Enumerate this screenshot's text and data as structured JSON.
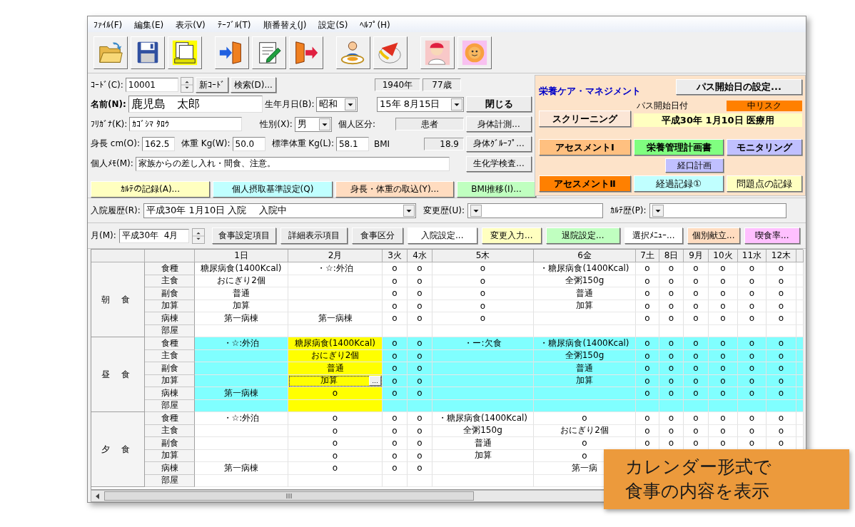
{
  "menu": [
    "ﾌｧｲﾙ(F)",
    "編集(E)",
    "表示(V)",
    "ﾃｰﾌﾞﾙ(T)",
    "順番替え(J)",
    "設定(S)",
    "ﾍﾙﾌﾟ(H)"
  ],
  "form": {
    "code": {
      "label": "ｺｰﾄﾞ(C):",
      "value": "10001"
    },
    "new_code_button": "新ｺｰﾄﾞ",
    "search_button": "検索(D)...",
    "birth_year": "1940年",
    "age": "77歳",
    "name": {
      "label": "名前(N):",
      "value": "鹿児島　太郎"
    },
    "birthdate": {
      "label": "生年月日(B):",
      "era": "昭和",
      "date": "15年 8月15日"
    },
    "kana": {
      "label": "ﾌﾘｶﾞﾅ(K):",
      "value": "ｶｺﾞｼﾏ ﾀﾛｳ"
    },
    "sex": {
      "label": "性別(X):",
      "value": "男"
    },
    "category": {
      "label": "個人区分:",
      "value": "患者"
    },
    "height": {
      "label": "身長 cm(O):",
      "value": "162.5"
    },
    "weight": {
      "label": "体重 Kg(W):",
      "value": "50.0"
    },
    "std_weight": {
      "label": "標準体重 Kg(L):",
      "value": "58.1"
    },
    "bmi": {
      "label": "BMI",
      "value": "18.9"
    },
    "memo": {
      "label": "個人ﾒﾓ(M):",
      "value": "家族からの差し入れ・間食、注意。"
    }
  },
  "side_buttons": [
    "閉じる",
    "身体計測...",
    "身体ｸﾞﾙｰﾌﾟ...",
    "生化学検査..."
  ],
  "record_buttons": [
    {
      "label": "ｶﾙﾃの記録(A)...",
      "color": "#ffffc0"
    },
    {
      "label": "個人摂取基準設定(Q)",
      "color": "#c0ffff"
    },
    {
      "label": "身長・体重の取込(Y)...",
      "color": "#ffdcc0"
    },
    {
      "label": "BMI推移(I)...",
      "color": "#c0ffc0"
    }
  ],
  "care": {
    "title": "栄養ケア・マネジメント",
    "path_button": "パス開始日の設定...",
    "path_date_label": "パス開始日付",
    "risk": "中リスク",
    "screening_button": "スクリーニング",
    "path_date": "平成30年 1月10日 医療用",
    "button_rows": [
      [
        {
          "label": "アセスメントⅠ",
          "color": "#ffc080",
          "kind": "primary"
        },
        {
          "label": "栄養管理計画書",
          "color": "#80ff80",
          "kind": "primary"
        },
        {
          "label": "モニタリング",
          "color": "#c0c0ff",
          "kind": "primary"
        }
      ],
      [
        {
          "label": "経口計画",
          "color": "#c0c0ff",
          "kind": "secondary"
        }
      ],
      [
        {
          "label": "アセスメントⅡ",
          "color": "#ff8000",
          "kind": "primary"
        },
        {
          "label": "経過記録①",
          "color": "#c0ffff",
          "kind": "secondary"
        },
        {
          "label": "問題点の記録",
          "color": "#ffffc0",
          "kind": "secondary"
        }
      ]
    ]
  },
  "history": [
    {
      "label": "入院履歴(R):",
      "value": "平成30年  1月10日  入院　 入院中"
    },
    {
      "label": "変更歴(U):"
    },
    {
      "label": "ｶﾙﾃ歴(P):"
    }
  ],
  "month": {
    "label": "月(M):",
    "value": "平成30年  4月"
  },
  "actions": [
    {
      "label": "食事設定項目",
      "color": "#ececec"
    },
    {
      "label": "詳細表示項目",
      "color": "#ececec"
    },
    {
      "label": "食事区分",
      "color": "#ececec"
    },
    {
      "label": "入院設定...",
      "color": "#ffffff"
    },
    {
      "label": "変更入力...",
      "color": "#ffffc0"
    },
    {
      "label": "退院設定...",
      "color": "#c0ffc0"
    },
    {
      "label": "選択ﾒﾆｭｰ...",
      "color": "#ffffff"
    },
    {
      "label": "個別献立...",
      "color": "#ffdcc0"
    },
    {
      "label": "喫食率...",
      "color": "#ffc0ff"
    }
  ],
  "grid": {
    "edit_button": "...",
    "days": [
      {
        "label": "1日",
        "selected": false
      },
      {
        "label": "2月",
        "selected": true
      },
      {
        "label": "3火",
        "selected": false
      },
      {
        "label": "4水",
        "selected": false
      },
      {
        "label": "5木",
        "selected": false
      },
      {
        "label": "6金",
        "selected": false
      },
      {
        "label": "7土",
        "selected": false
      },
      {
        "label": "8日",
        "selected": false
      },
      {
        "label": "9月",
        "selected": false
      },
      {
        "label": "10火",
        "selected": false
      },
      {
        "label": "11水",
        "selected": false
      },
      {
        "label": "12木",
        "selected": false
      }
    ],
    "meals": [
      {
        "label": "朝 食",
        "selected": false,
        "rows": [
          {
            "label": "食種",
            "cells": [
              "糖尿病食(1400Kcal)",
              "・☆:外泊",
              "o",
              "o",
              "o",
              "・糖尿病食(1400Kcal)",
              "o",
              "o",
              "o",
              "o",
              "o",
              "o"
            ]
          },
          {
            "label": "主食",
            "cells": [
              "おにぎり2個",
              null,
              "o",
              "o",
              "o",
              "全粥150g",
              "o",
              "o",
              "o",
              "o",
              "o",
              "o"
            ]
          },
          {
            "label": "副食",
            "cells": [
              "普通",
              null,
              "o",
              "o",
              "o",
              "普通",
              "o",
              "o",
              "o",
              "o",
              "o",
              "o"
            ]
          },
          {
            "label": "加算",
            "cells": [
              "加算",
              null,
              "o",
              "o",
              "o",
              "加算",
              "o",
              "o",
              "o",
              "o",
              "o",
              "o"
            ]
          },
          {
            "label": "病棟",
            "cells": [
              "第一病棟",
              "第一病棟",
              "o",
              "o",
              "o",
              null,
              "o",
              "o",
              "o",
              "o",
              "o",
              "o"
            ]
          },
          {
            "label": "部屋",
            "cells": [
              null,
              null,
              null,
              null,
              null,
              null,
              null,
              null,
              null,
              null,
              null,
              null
            ]
          }
        ]
      },
      {
        "label": "昼 食",
        "selected": true,
        "rows": [
          {
            "label": "食種",
            "cells": [
              "・☆:外泊",
              "糖尿病食(1400Kcal)",
              "o",
              "o",
              "・ー:欠食",
              "・糖尿病食(1400Kcal)",
              "o",
              "o",
              "o",
              "o",
              "o",
              "o"
            ]
          },
          {
            "label": "主食",
            "cells": [
              null,
              "おにぎり2個",
              "o",
              "o",
              null,
              "全粥150g",
              "o",
              "o",
              "o",
              "o",
              "o",
              "o"
            ]
          },
          {
            "label": "副食",
            "cells": [
              null,
              "普通",
              "o",
              "o",
              null,
              "普通",
              "o",
              "o",
              "o",
              "o",
              "o",
              "o"
            ]
          },
          {
            "label": "加算",
            "cells": [
              null,
              {
                "text": "加算",
                "editing": true
              },
              "o",
              "o",
              null,
              "加算",
              "o",
              "o",
              "o",
              "o",
              "o",
              "o"
            ]
          },
          {
            "label": "病棟",
            "cells": [
              "第一病棟",
              "o",
              "o",
              "o",
              null,
              null,
              "o",
              "o",
              "o",
              "o",
              "o",
              "o"
            ]
          },
          {
            "label": "部屋",
            "cells": [
              null,
              null,
              null,
              null,
              null,
              null,
              null,
              null,
              null,
              null,
              null,
              null
            ]
          }
        ]
      },
      {
        "label": "夕 食",
        "selected": false,
        "rows": [
          {
            "label": "食種",
            "cells": [
              "・☆:外泊",
              "o",
              "o",
              "o",
              "・糖尿病食(1400Kcal)",
              "o",
              "o",
              "o",
              "o",
              "o",
              "o",
              "o"
            ]
          },
          {
            "label": "主食",
            "cells": [
              null,
              "o",
              "o",
              "o",
              "全粥150g",
              "おにぎり2個",
              "o",
              "o",
              "o",
              "o",
              "o",
              "o"
            ]
          },
          {
            "label": "副食",
            "cells": [
              null,
              "o",
              "o",
              "o",
              "普通",
              "o",
              "o",
              "o",
              "o",
              "o",
              "o",
              "o"
            ]
          },
          {
            "label": "加算",
            "cells": [
              null,
              "o",
              "o",
              "o",
              "加算",
              "o",
              null,
              null,
              null,
              null,
              null,
              null
            ]
          },
          {
            "label": "病棟",
            "cells": [
              "第一病棟",
              "o",
              "o",
              "o",
              null,
              "第一病",
              null,
              null,
              null,
              null,
              null,
              null
            ]
          },
          {
            "label": "部屋",
            "cells": [
              null,
              null,
              null,
              null,
              null,
              null,
              null,
              null,
              null,
              null,
              null,
              null
            ]
          }
        ]
      }
    ]
  },
  "note": {
    "lines": [
      "カレンダー形式で",
      "食事の内容を表示"
    ]
  }
}
